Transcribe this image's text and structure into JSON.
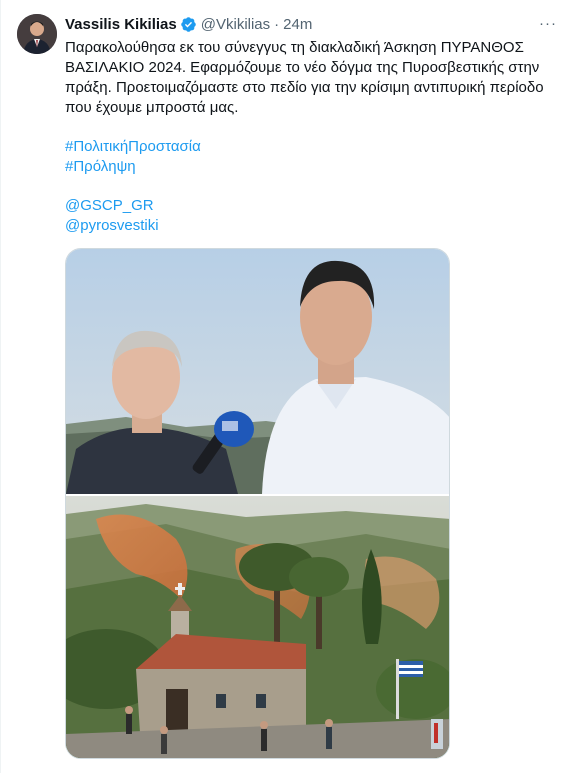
{
  "tweet": {
    "author_name": "Vassilis Kikilias",
    "handle": "@Vkikilias",
    "separator": "·",
    "time": "24m",
    "more_label": "···",
    "text_lines": [
      "Παρακολούθησα εκ του σύνεγγυς τη διακλαδική Άσκηση ΠΥΡΑΝΘΟΣ",
      "ΒΑΣΙΛΑΚΙΟ 2024. Εφαρμόζουμε το νέο δόγμα της Πυροσβεστικής στην",
      "πράξη. Προετοιμαζόμαστε στο πεδίο για την κρίσιμη αντιπυρική περίοδο",
      "που έχουμε μπροστά μας."
    ],
    "hashtags": [
      "#ΠολιτικήΠροστασία",
      "#Πρόληψη"
    ],
    "mentions": [
      "@GSCP_GR",
      "@pyrosvestiki"
    ],
    "media": {
      "top_image_icon": "interview-photo",
      "bottom_image_icon": "wildfire-exercise-photo"
    }
  },
  "colors": {
    "text": "#0f1419",
    "secondary": "#536471",
    "link": "#1d9bf0",
    "verified": "#1d9bf0",
    "border": "#cfd9de"
  }
}
